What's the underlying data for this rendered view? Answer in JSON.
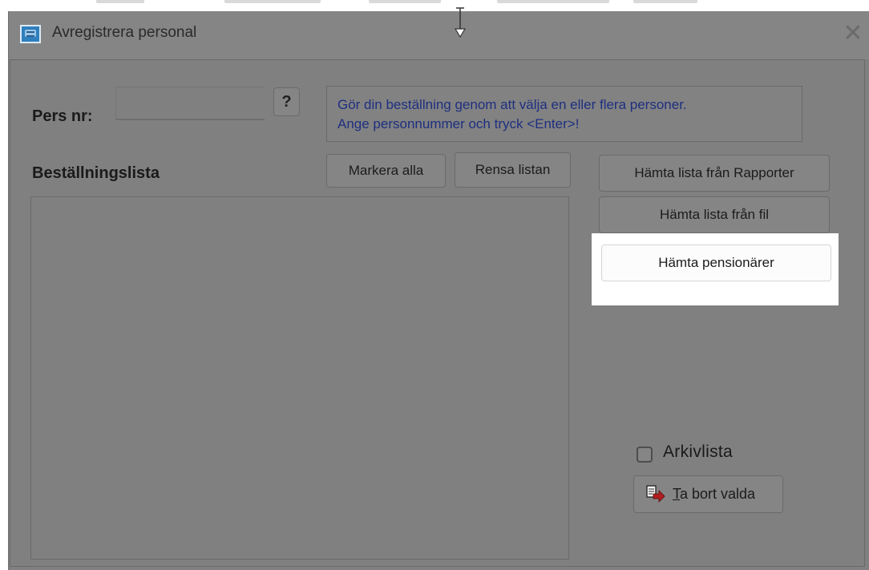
{
  "window": {
    "title": "Avregistrera personal",
    "close_symbol": "✕"
  },
  "pers": {
    "label": "Pers nr:",
    "value": "",
    "help_label": "?"
  },
  "info": {
    "line1": "Gör din beställning genom att välja en eller flera personer.",
    "line2": "Ange personnummer och tryck <Enter>!"
  },
  "order_list": {
    "label": "Beställningslista",
    "items": []
  },
  "buttons": {
    "markera_alla": "Markera alla",
    "rensa_listan": "Rensa listan",
    "hamta_rapporter": "Hämta lista från Rapporter",
    "hamta_fil": "Hämta lista från fil",
    "hamta_pensionarer": "Hämta pensionärer",
    "ta_bort_first": "T",
    "ta_bort_rest": "a bort valda"
  },
  "archive": {
    "label": "Arkivlista",
    "checked": false
  },
  "icons": {
    "app": "app-window-icon",
    "close": "close-icon",
    "cursor": "text-cursor-icon",
    "delete": "remove-selected-icon"
  },
  "colors": {
    "dim_overlay": "#808080",
    "highlight": "#ffffff",
    "info_text": "#1e2f80"
  }
}
